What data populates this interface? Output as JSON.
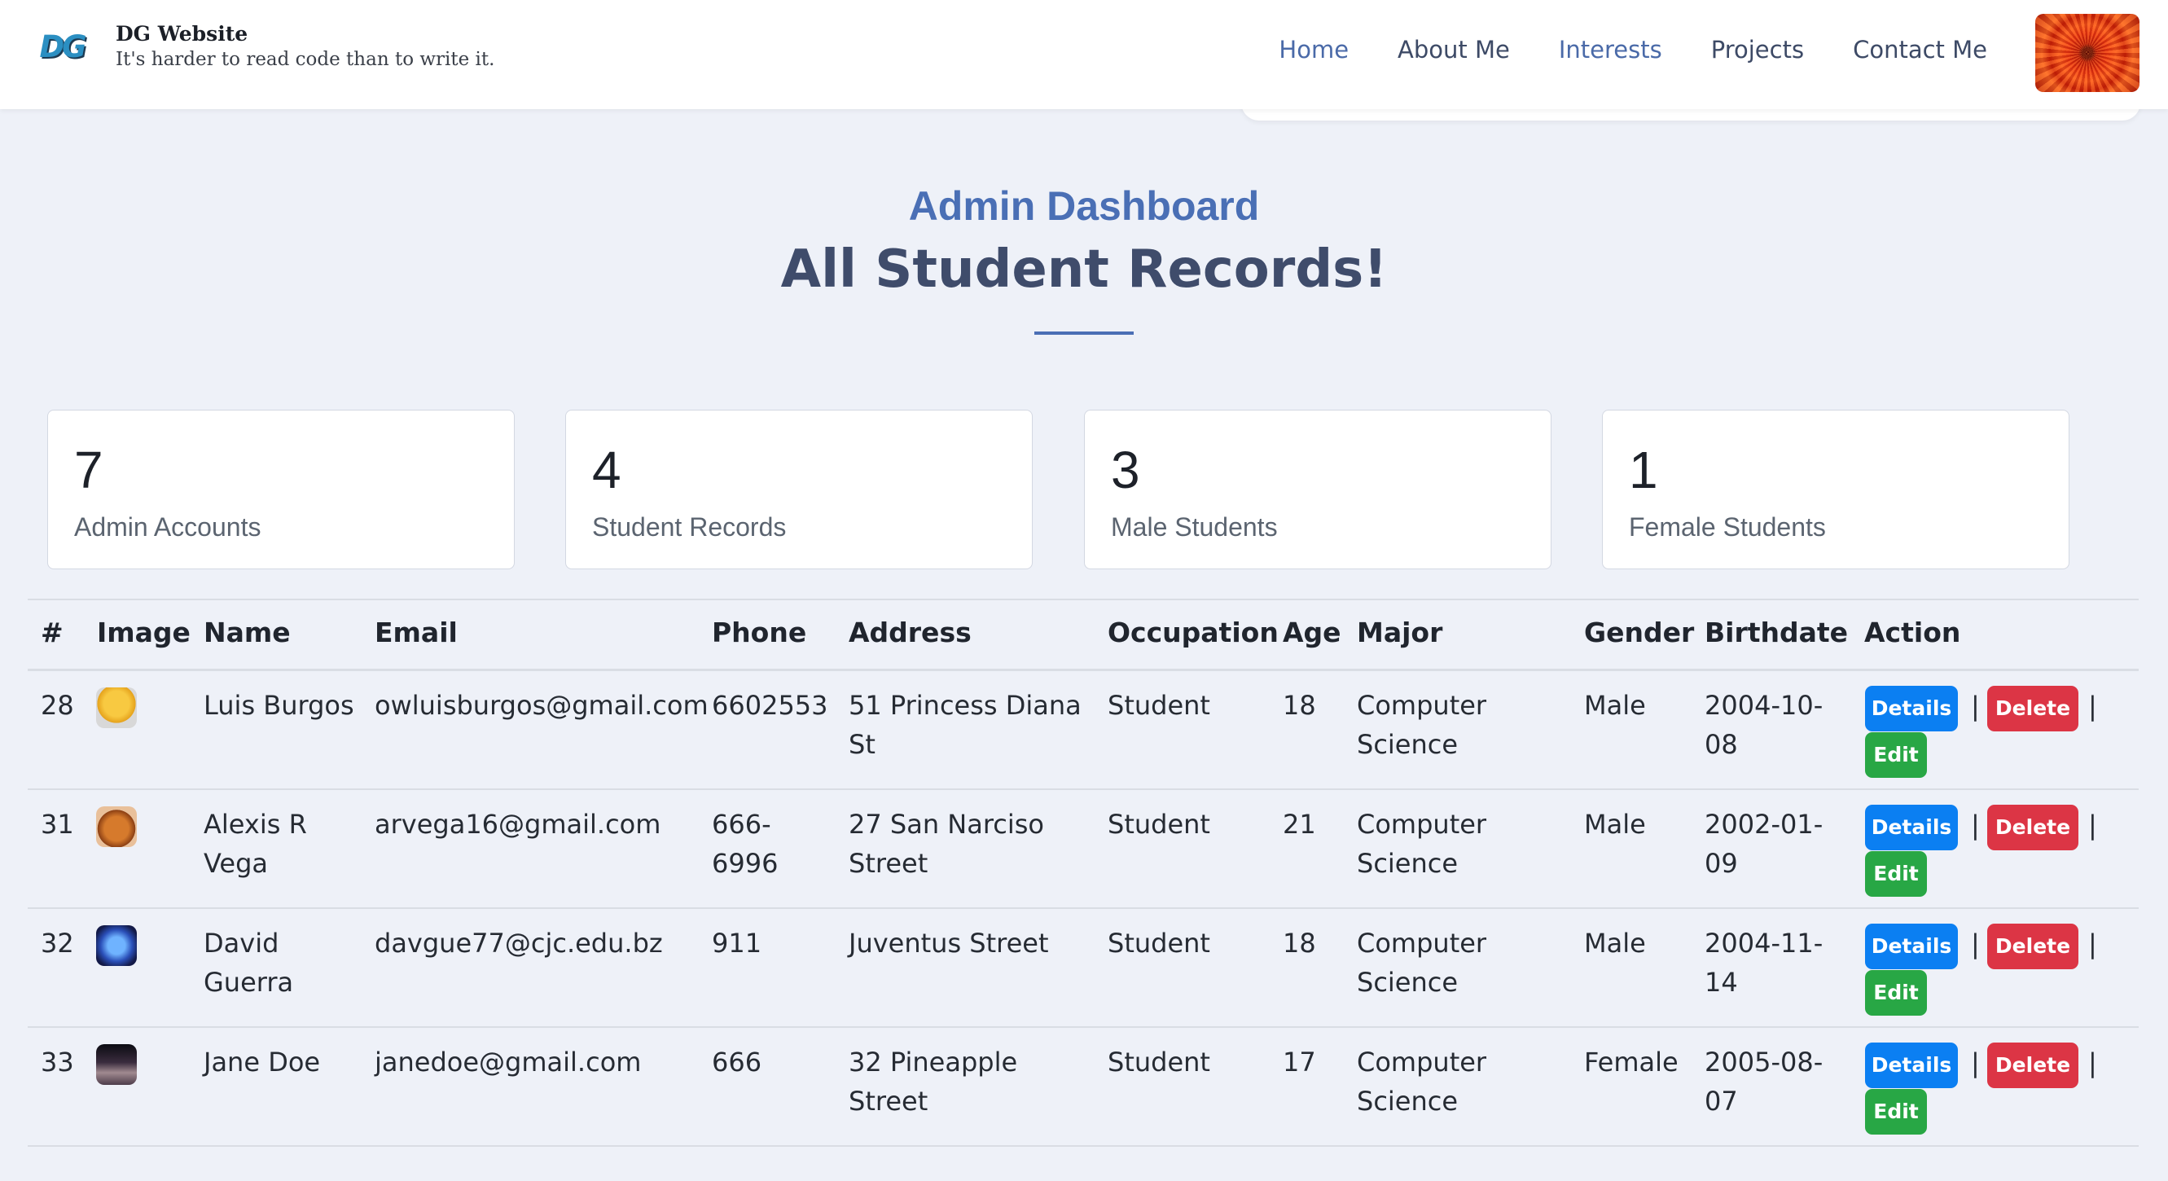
{
  "brand": {
    "logo_text": "DG",
    "title": "DG Website",
    "tagline": "It's harder to read code than to write it."
  },
  "nav": {
    "items": [
      "Home",
      "About Me",
      "Interests",
      "Projects",
      "Contact Me"
    ]
  },
  "page": {
    "subtitle": "Admin Dashboard",
    "title": "All Student Records!"
  },
  "stats": [
    {
      "value": "7",
      "label": "Admin Accounts"
    },
    {
      "value": "4",
      "label": "Student Records"
    },
    {
      "value": "3",
      "label": "Male Students"
    },
    {
      "value": "1",
      "label": "Female Students"
    }
  ],
  "table": {
    "headers": [
      "#",
      "Image",
      "Name",
      "Email",
      "Phone",
      "Address",
      "Occupation",
      "Age",
      "Major",
      "Gender",
      "Birthdate",
      "Action"
    ],
    "rows": [
      {
        "id": "28",
        "name": [
          "Luis Burgos",
          ""
        ],
        "email": "owluisburgos@gmail.com",
        "phone": [
          "6602553",
          ""
        ],
        "address": [
          "51 Princess Diana",
          "St"
        ],
        "occupation": "Student",
        "age": "18",
        "major": [
          "Computer",
          "Science"
        ],
        "gender": "Male",
        "birthdate": [
          "2004-10-",
          "08"
        ]
      },
      {
        "id": "31",
        "name": [
          "Alexis R",
          "Vega"
        ],
        "email": "arvega16@gmail.com",
        "phone": [
          "666-",
          "6996"
        ],
        "address": [
          "27 San Narciso",
          "Street"
        ],
        "occupation": "Student",
        "age": "21",
        "major": [
          "Computer",
          "Science"
        ],
        "gender": "Male",
        "birthdate": [
          "2002-01-",
          "09"
        ]
      },
      {
        "id": "32",
        "name": [
          "David",
          "Guerra"
        ],
        "email": "davgue77@cjc.edu.bz",
        "phone": [
          "911",
          ""
        ],
        "address": [
          "Juventus Street",
          ""
        ],
        "occupation": "Student",
        "age": "18",
        "major": [
          "Computer",
          "Science"
        ],
        "gender": "Male",
        "birthdate": [
          "2004-11-",
          "14"
        ]
      },
      {
        "id": "33",
        "name": [
          "Jane Doe",
          ""
        ],
        "email": "janedoe@gmail.com",
        "phone": [
          "666",
          ""
        ],
        "address": [
          "32 Pineapple",
          "Street"
        ],
        "occupation": "Student",
        "age": "17",
        "major": [
          "Computer",
          "Science"
        ],
        "gender": "Female",
        "birthdate": [
          "2005-08-",
          "07"
        ]
      }
    ],
    "actions": {
      "details": "Details",
      "delete": "Delete",
      "edit": "Edit",
      "separator": "|"
    }
  }
}
